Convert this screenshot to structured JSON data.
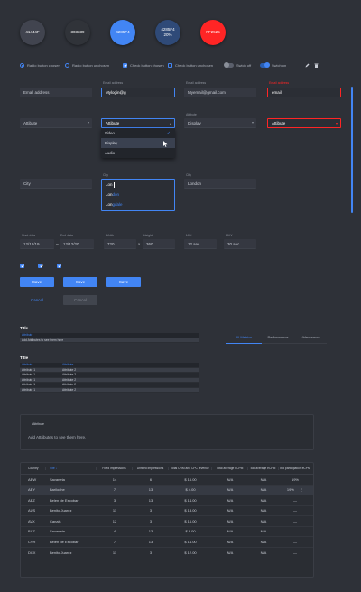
{
  "swatches": [
    {
      "label": "41444F",
      "color": "#41444f"
    },
    {
      "label": "303339",
      "color": "#303339"
    },
    {
      "label": "4285F4",
      "color": "#4285f4"
    },
    {
      "label": "4285F4",
      "sub": "20%",
      "color": "#2f4a78"
    },
    {
      "label": "FF2525",
      "color": "#ff2525"
    }
  ],
  "controls": {
    "radio_chosen": "Radio button chosen",
    "radio_unchosen": "Radio button unchosen",
    "check_chosen": "Check button chosen",
    "check_unchosen": "Check button unchosen",
    "switch_off": "Swich off",
    "switch_on": "Swich on"
  },
  "fields_row1": {
    "email_placeholder": "Email address",
    "email_label": "Email address",
    "email_value": "Mylogin@g",
    "email2_label": "Email address",
    "email2_value": "Myemail@gmail.com",
    "email_err_label": "Email address",
    "email_err_value": "email"
  },
  "fields_row2": {
    "attr1": "Attibute",
    "attr2": "Attibute",
    "attr_label": "Attibute",
    "attr3": "Display",
    "attr4": "Attibute",
    "menu": [
      "Video",
      "Display",
      "Audio"
    ]
  },
  "fields_row3": {
    "city1": "City",
    "city_label": "City",
    "city_value": "Lon",
    "city3_label": "City",
    "city3_value": "London",
    "suggestions": [
      {
        "match": "Lon",
        "rest": "don"
      },
      {
        "match": "Lon",
        "rest": "don"
      },
      {
        "match": "Lon",
        "rest": "gdale"
      }
    ]
  },
  "fields_row4": {
    "start_label": "Start date",
    "start": "12/12/19",
    "end_label": "End date",
    "end": "12/12/20",
    "width_label": "Width",
    "width": "720",
    "height_label": "Height",
    "height": "360",
    "min_label": "MIN",
    "min": "12 sec",
    "max_label": "MAX",
    "max": "30 sec"
  },
  "buttons": {
    "save": "Save",
    "cancel": "Cancel"
  },
  "panel1": {
    "title": "Title",
    "header": "Attribute",
    "row": "Add Attributes to see them here"
  },
  "tabs": [
    "All Metrics",
    "Performance",
    "Video errors"
  ],
  "panel2": {
    "title": "Title",
    "headers": [
      "Attribute",
      "Attribute"
    ],
    "rows": [
      [
        "Attribute 1",
        "Attribute 2"
      ],
      [
        "Attribute 1",
        "Attribute 2"
      ],
      [
        "Attribute 1",
        "Attribute 2"
      ],
      [
        "Attribute 1",
        "Attribute 2"
      ],
      [
        "Attribute 1",
        "Attribute 2"
      ]
    ]
  },
  "attr_box": {
    "label": "Attribute",
    "empty": "Add Attributes to see them here."
  },
  "table": {
    "headers": [
      "Country",
      "Site",
      "Filled impressions",
      "Unfilled impressions",
      "Total CRM and CPC revenue",
      "Total average eCPM",
      "Bid average eCPM",
      "Bid participation eCPM"
    ],
    "rows": [
      [
        "ABW",
        "Savaneta",
        "14",
        "6",
        "$ 16.00",
        "N/A",
        "N/A",
        "19%"
      ],
      [
        "ABY",
        "Bariloche",
        "7",
        "13",
        "$ 4.00",
        "N/A",
        "N/A",
        "19%"
      ],
      [
        "ABZ",
        "Belen de Escobar",
        "3",
        "13",
        "$ 14.00",
        "N/A",
        "N/A",
        "—"
      ],
      [
        "AUS",
        "Benito Juarez",
        "11",
        "3",
        "$ 13.00",
        "N/A",
        "N/A",
        "—"
      ],
      [
        "AVX",
        "Canals",
        "12",
        "3",
        "$ 16.00",
        "N/A",
        "N/A",
        "—"
      ],
      [
        "BXZ",
        "Savaneta",
        "4",
        "13",
        "$ 8.00",
        "N/A",
        "N/A",
        "—"
      ],
      [
        "CVR",
        "Belen de Escobar",
        "7",
        "13",
        "$ 14.00",
        "N/A",
        "N/A",
        "—"
      ],
      [
        "DCX",
        "Benito Juarez",
        "11",
        "3",
        "$ 12.00",
        "N/A",
        "N/A",
        "—"
      ]
    ]
  }
}
